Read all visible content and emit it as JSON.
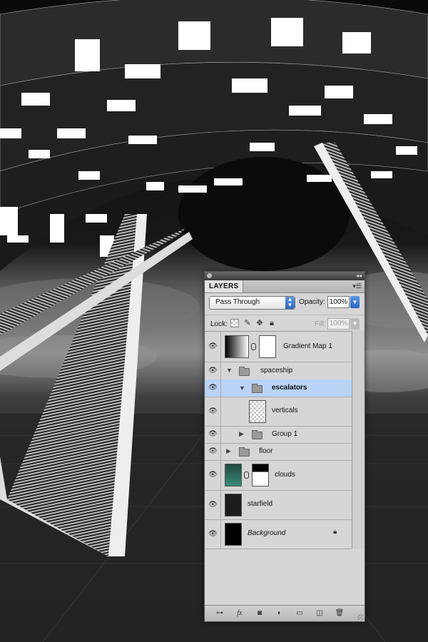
{
  "panel": {
    "tab_label": "LAYERS",
    "menu_icon": "panel-menu-icon",
    "collapse_glyph": "◂◂"
  },
  "blend": {
    "mode": "Pass Through",
    "opacity_label": "Opacity:",
    "opacity_value": "100%"
  },
  "lock": {
    "label": "Lock:",
    "icons": [
      "lock-transparent-icon",
      "lock-image-icon",
      "lock-position-icon",
      "lock-all-icon"
    ],
    "fill_label": "Fill:",
    "fill_value": "100%"
  },
  "layers": [
    {
      "name": "Gradient Map 1",
      "type": "adjustment",
      "indent": 0
    },
    {
      "name": "spaceship",
      "type": "group",
      "expanded": true,
      "indent": 0
    },
    {
      "name": "escalators",
      "type": "group",
      "expanded": true,
      "indent": 1,
      "selected": true
    },
    {
      "name": "verticals",
      "type": "layer",
      "indent": 2
    },
    {
      "name": "Group 1",
      "type": "group",
      "expanded": false,
      "indent": 1
    },
    {
      "name": "floor",
      "type": "group",
      "expanded": false,
      "indent": 0
    },
    {
      "name": "clouds",
      "type": "layer-with-mask",
      "indent": 0
    },
    {
      "name": "starfield",
      "type": "layer",
      "indent": 0
    },
    {
      "name": "Background",
      "type": "background",
      "indent": 0,
      "locked": true
    }
  ],
  "bottom_icons": [
    "link-layers-icon",
    "fx-icon",
    "add-mask-icon",
    "new-adjustment-icon",
    "new-group-icon",
    "new-layer-icon",
    "trash-icon"
  ],
  "colors": {
    "selection": "#b9d3f7",
    "accent": "#2b63c4",
    "panel_bg": "#d6d6d6"
  }
}
